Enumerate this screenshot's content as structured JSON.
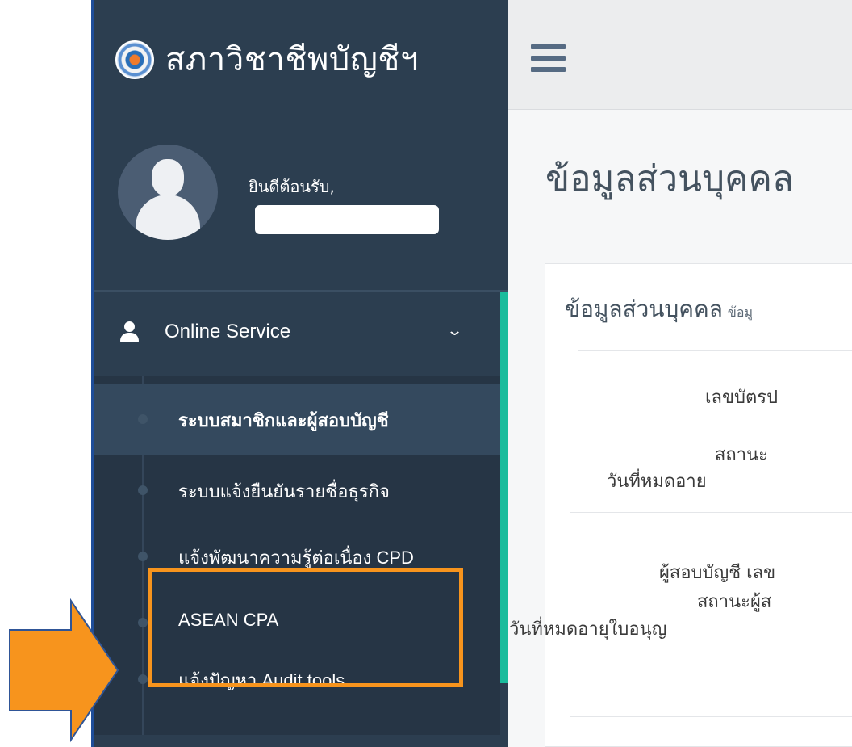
{
  "sidebar": {
    "brand_name": "สภาวิชาชีพบัญชีฯ",
    "welcome": "ยินดีต้อนรับ,",
    "menu_header": "Online Service",
    "items": [
      {
        "label": "ระบบสมาชิกและผู้สอบบัญชี",
        "active": true
      },
      {
        "label": "ระบบแจ้งยืนยันรายชื่อธุรกิจ",
        "active": false
      },
      {
        "label": "แจ้งพัฒนาความรู้ต่อเนื่อง CPD",
        "active": false
      },
      {
        "label": "ASEAN CPA",
        "active": false
      },
      {
        "label": "แจ้งปัญหา Audit tools",
        "active": false,
        "highlighted": true
      }
    ]
  },
  "main": {
    "page_title": "ข้อมูลส่วนบุคคล",
    "panel_title": "ข้อมูลส่วนบุคคล",
    "panel_subtitle": "ข้อมู",
    "fields": [
      "เลขบัตรป",
      "สถานะ",
      "วันที่หมดอาย",
      "ผู้สอบบัญชี เลข",
      "สถานะผู้ส",
      "วันที่หมดอายุใบอนุญ"
    ]
  },
  "colors": {
    "sidebar_bg": "#2c3e50",
    "accent": "#1abc9c",
    "highlight": "#f7941d"
  }
}
